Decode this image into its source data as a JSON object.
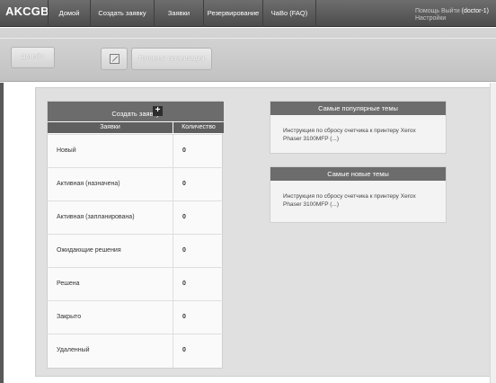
{
  "app": {
    "brand": "AKCGB"
  },
  "nav": {
    "items": [
      {
        "label": "Домой"
      },
      {
        "label": "Создать заявку"
      },
      {
        "label": "Заявки"
      },
      {
        "label": "Резервирование"
      },
      {
        "label": "ЧаВо (FAQ)"
      }
    ]
  },
  "user": {
    "help": "Помощь",
    "logout": "Выйти",
    "username": "(doctor-1)",
    "settings": "Настройки"
  },
  "breadcrumb": {
    "home": "Домой>"
  },
  "org": {
    "label": "Головная организация",
    "icon": "image-placeholder-icon"
  },
  "tickets": {
    "create_label": "Создать заявку",
    "columns": [
      "Заявки",
      "Количество"
    ],
    "rows": [
      {
        "name": "Новый",
        "count": "0"
      },
      {
        "name": "Активная (назначена)",
        "count": "0"
      },
      {
        "name": "Активная (запланирована)",
        "count": "0"
      },
      {
        "name": "Ожидающие решения",
        "count": "0"
      },
      {
        "name": "Решена",
        "count": "0"
      },
      {
        "name": "Закрыто",
        "count": "0"
      },
      {
        "name": "Удаленный",
        "count": "0"
      }
    ]
  },
  "popular": {
    "title": "Самые популярные темы",
    "link": "Инструкция по сбросу счетчика к принтеру Xerox Phaser 3100MFP (...)"
  },
  "newest": {
    "title": "Самые новые темы",
    "link": "Инструкция по сбросу счетчика к принтеру Xerox Phaser 3100MFP (...)"
  },
  "colors": {
    "nav_bg": "#555555",
    "header_bg": "#6c6c6c",
    "panel_bg": "#e0e0e0"
  }
}
